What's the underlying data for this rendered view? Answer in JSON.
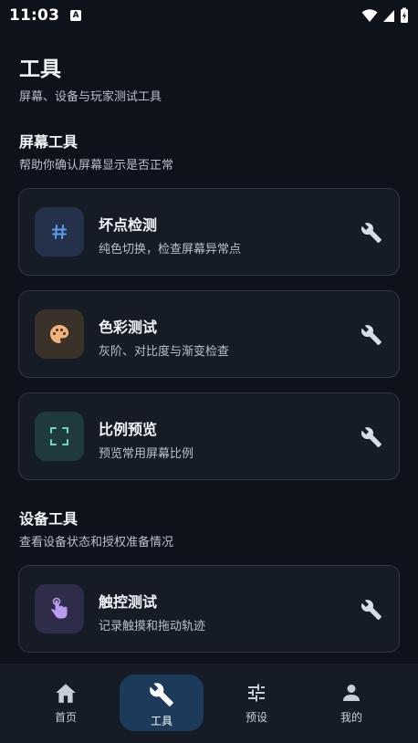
{
  "status_bar": {
    "time": "11:03",
    "notification_badge": "A"
  },
  "header": {
    "title": "工具",
    "subtitle": "屏幕、设备与玩家测试工具"
  },
  "sections": [
    {
      "title": "屏幕工具",
      "subtitle": "帮助你确认屏幕显示是否正常",
      "cards": [
        {
          "title": "坏点检测",
          "description": "纯色切换，检查屏幕异常点",
          "icon": "hash-icon",
          "icon_color": "#5b9ef0",
          "icon_bg": "#23324a"
        },
        {
          "title": "色彩测试",
          "description": "灰阶、对比度与渐变检查",
          "icon": "palette-icon",
          "icon_color": "#f0b27a",
          "icon_bg": "#3a3128"
        },
        {
          "title": "比例预览",
          "description": "预览常用屏幕比例",
          "icon": "crop-frame-icon",
          "icon_color": "#6fd6c4",
          "icon_bg": "#1f3a3a"
        }
      ]
    },
    {
      "title": "设备工具",
      "subtitle": "查看设备状态和授权准备情况",
      "cards": [
        {
          "title": "触控测试",
          "description": "记录触摸和拖动轨迹",
          "icon": "touch-icon",
          "icon_color": "#b89cf0",
          "icon_bg": "#2e2c48"
        }
      ]
    }
  ],
  "bottom_nav": [
    {
      "label": "首页",
      "icon": "home-icon",
      "active": false
    },
    {
      "label": "工具",
      "icon": "wrench-icon",
      "active": true
    },
    {
      "label": "预设",
      "icon": "sliders-icon",
      "active": false
    },
    {
      "label": "我的",
      "icon": "person-icon",
      "active": false
    }
  ],
  "colors": {
    "background": "#0e131b",
    "card": "#161c26",
    "card_border": "#2f3846",
    "nav_active": "#1c3a5a"
  }
}
